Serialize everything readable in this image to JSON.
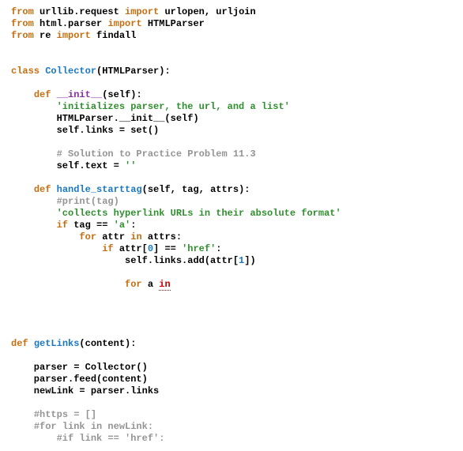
{
  "code": {
    "lines": [
      {
        "segs": [
          {
            "cls": "k",
            "t": "from"
          },
          {
            "cls": "plain",
            "t": " urllib.request "
          },
          {
            "cls": "k",
            "t": "import"
          },
          {
            "cls": "plain",
            "t": " urlopen, urljoin"
          }
        ]
      },
      {
        "segs": [
          {
            "cls": "k",
            "t": "from"
          },
          {
            "cls": "plain",
            "t": " html.parser "
          },
          {
            "cls": "k",
            "t": "import"
          },
          {
            "cls": "plain",
            "t": " HTMLParser"
          }
        ]
      },
      {
        "segs": [
          {
            "cls": "k",
            "t": "from"
          },
          {
            "cls": "plain",
            "t": " re "
          },
          {
            "cls": "k",
            "t": "import"
          },
          {
            "cls": "plain",
            "t": " findall"
          }
        ]
      },
      {
        "segs": [
          {
            "cls": "plain",
            "t": ""
          }
        ]
      },
      {
        "segs": [
          {
            "cls": "plain",
            "t": ""
          }
        ]
      },
      {
        "segs": [
          {
            "cls": "k",
            "t": "class"
          },
          {
            "cls": "plain",
            "t": " "
          },
          {
            "cls": "cn",
            "t": "Collector"
          },
          {
            "cls": "plain",
            "t": "(HTMLParser):"
          }
        ]
      },
      {
        "segs": [
          {
            "cls": "plain",
            "t": ""
          }
        ]
      },
      {
        "segs": [
          {
            "cls": "plain",
            "t": "    "
          },
          {
            "cls": "k",
            "t": "def"
          },
          {
            "cls": "plain",
            "t": " "
          },
          {
            "cls": "du",
            "t": "__init__"
          },
          {
            "cls": "plain",
            "t": "(self):"
          }
        ]
      },
      {
        "segs": [
          {
            "cls": "plain",
            "t": "        "
          },
          {
            "cls": "s",
            "t": "'initializes parser, the url, and a list'"
          }
        ]
      },
      {
        "segs": [
          {
            "cls": "plain",
            "t": "        HTMLParser.__init__(self)"
          }
        ]
      },
      {
        "segs": [
          {
            "cls": "plain",
            "t": "        self.links = set()"
          }
        ]
      },
      {
        "segs": [
          {
            "cls": "plain",
            "t": ""
          }
        ]
      },
      {
        "segs": [
          {
            "cls": "plain",
            "t": "        "
          },
          {
            "cls": "c",
            "t": "# Solution to Practice Problem 11.3"
          }
        ]
      },
      {
        "segs": [
          {
            "cls": "plain",
            "t": "        self.text = "
          },
          {
            "cls": "s",
            "t": "''"
          }
        ]
      },
      {
        "segs": [
          {
            "cls": "plain",
            "t": ""
          }
        ]
      },
      {
        "segs": [
          {
            "cls": "plain",
            "t": "    "
          },
          {
            "cls": "k",
            "t": "def"
          },
          {
            "cls": "plain",
            "t": " "
          },
          {
            "cls": "fn",
            "t": "handle_starttag"
          },
          {
            "cls": "plain",
            "t": "(self, tag, attrs):"
          }
        ]
      },
      {
        "segs": [
          {
            "cls": "plain",
            "t": "        "
          },
          {
            "cls": "c",
            "t": "#print(tag)"
          }
        ]
      },
      {
        "segs": [
          {
            "cls": "plain",
            "t": "        "
          },
          {
            "cls": "s",
            "t": "'collects hyperlink URLs in their absolute format'"
          }
        ]
      },
      {
        "segs": [
          {
            "cls": "plain",
            "t": "        "
          },
          {
            "cls": "k",
            "t": "if"
          },
          {
            "cls": "plain",
            "t": " tag == "
          },
          {
            "cls": "s",
            "t": "'a'"
          },
          {
            "cls": "plain",
            "t": ":"
          }
        ]
      },
      {
        "segs": [
          {
            "cls": "plain",
            "t": "            "
          },
          {
            "cls": "k",
            "t": "for"
          },
          {
            "cls": "plain",
            "t": " attr "
          },
          {
            "cls": "k",
            "t": "in"
          },
          {
            "cls": "plain",
            "t": " attrs:"
          }
        ]
      },
      {
        "segs": [
          {
            "cls": "plain",
            "t": "                "
          },
          {
            "cls": "k",
            "t": "if"
          },
          {
            "cls": "plain",
            "t": " attr["
          },
          {
            "cls": "n",
            "t": "0"
          },
          {
            "cls": "plain",
            "t": "] == "
          },
          {
            "cls": "s",
            "t": "'href'"
          },
          {
            "cls": "plain",
            "t": ":"
          }
        ]
      },
      {
        "segs": [
          {
            "cls": "plain",
            "t": "                    self.links.add(attr["
          },
          {
            "cls": "n",
            "t": "1"
          },
          {
            "cls": "plain",
            "t": "])"
          }
        ]
      },
      {
        "segs": [
          {
            "cls": "plain",
            "t": ""
          }
        ]
      },
      {
        "segs": [
          {
            "cls": "plain",
            "t": "                    "
          },
          {
            "cls": "k",
            "t": "for"
          },
          {
            "cls": "plain",
            "t": " a "
          },
          {
            "cls": "err",
            "t": "in"
          }
        ]
      },
      {
        "segs": [
          {
            "cls": "plain",
            "t": ""
          }
        ]
      },
      {
        "segs": [
          {
            "cls": "plain",
            "t": ""
          }
        ]
      },
      {
        "segs": [
          {
            "cls": "plain",
            "t": ""
          }
        ]
      },
      {
        "segs": [
          {
            "cls": "plain",
            "t": ""
          }
        ]
      },
      {
        "segs": [
          {
            "cls": "k",
            "t": "def"
          },
          {
            "cls": "plain",
            "t": " "
          },
          {
            "cls": "fn",
            "t": "getLinks"
          },
          {
            "cls": "plain",
            "t": "(content):"
          }
        ]
      },
      {
        "segs": [
          {
            "cls": "plain",
            "t": ""
          }
        ]
      },
      {
        "segs": [
          {
            "cls": "plain",
            "t": "    parser = Collector()"
          }
        ]
      },
      {
        "segs": [
          {
            "cls": "plain",
            "t": "    parser.feed(content)"
          }
        ]
      },
      {
        "segs": [
          {
            "cls": "plain",
            "t": "    newLink = parser.links"
          }
        ]
      },
      {
        "segs": [
          {
            "cls": "plain",
            "t": ""
          }
        ]
      },
      {
        "segs": [
          {
            "cls": "plain",
            "t": "    "
          },
          {
            "cls": "c",
            "t": "#https = []"
          }
        ]
      },
      {
        "segs": [
          {
            "cls": "plain",
            "t": "    "
          },
          {
            "cls": "c",
            "t": "#for link in newLink:"
          }
        ]
      },
      {
        "segs": [
          {
            "cls": "plain",
            "t": "        "
          },
          {
            "cls": "c",
            "t": "#if link == 'href':"
          }
        ]
      }
    ]
  }
}
